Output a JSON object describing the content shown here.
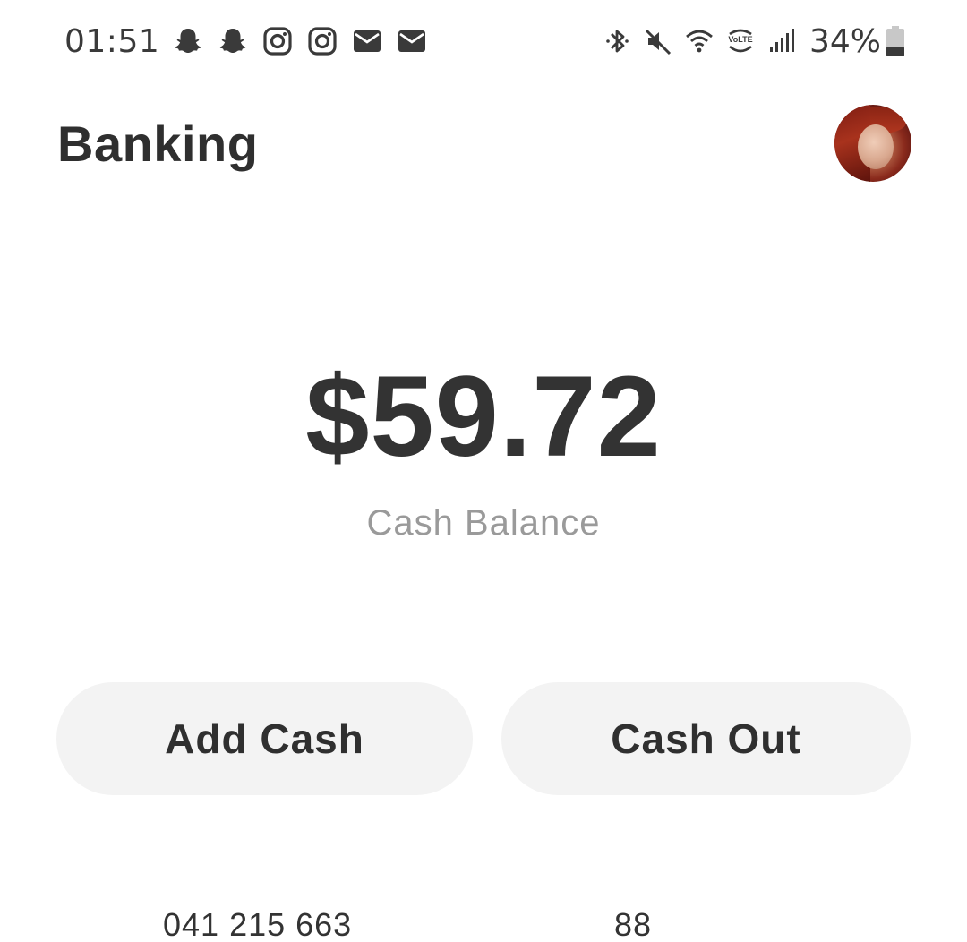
{
  "status_bar": {
    "time": "01:51",
    "notification_icons": [
      "snapchat-icon",
      "snapchat-icon",
      "instagram-icon",
      "instagram-icon",
      "mail-icon",
      "mail-icon"
    ],
    "system_icons": [
      "bluetooth-icon",
      "mute-icon",
      "wifi-icon",
      "volte-icon",
      "signal-icon"
    ],
    "battery_percent": "34%",
    "battery_level": 0.34
  },
  "header": {
    "title": "Banking"
  },
  "balance": {
    "amount": "$59.72",
    "label": "Cash Balance"
  },
  "actions": {
    "add_cash_label": "Add Cash",
    "cash_out_label": "Cash Out"
  },
  "account": {
    "number_partial": "041 215 663",
    "routing_partial": "88"
  },
  "colors": {
    "text_primary": "#333333",
    "text_secondary": "#9a9a9a",
    "button_bg": "#f3f3f3",
    "background": "#ffffff"
  }
}
